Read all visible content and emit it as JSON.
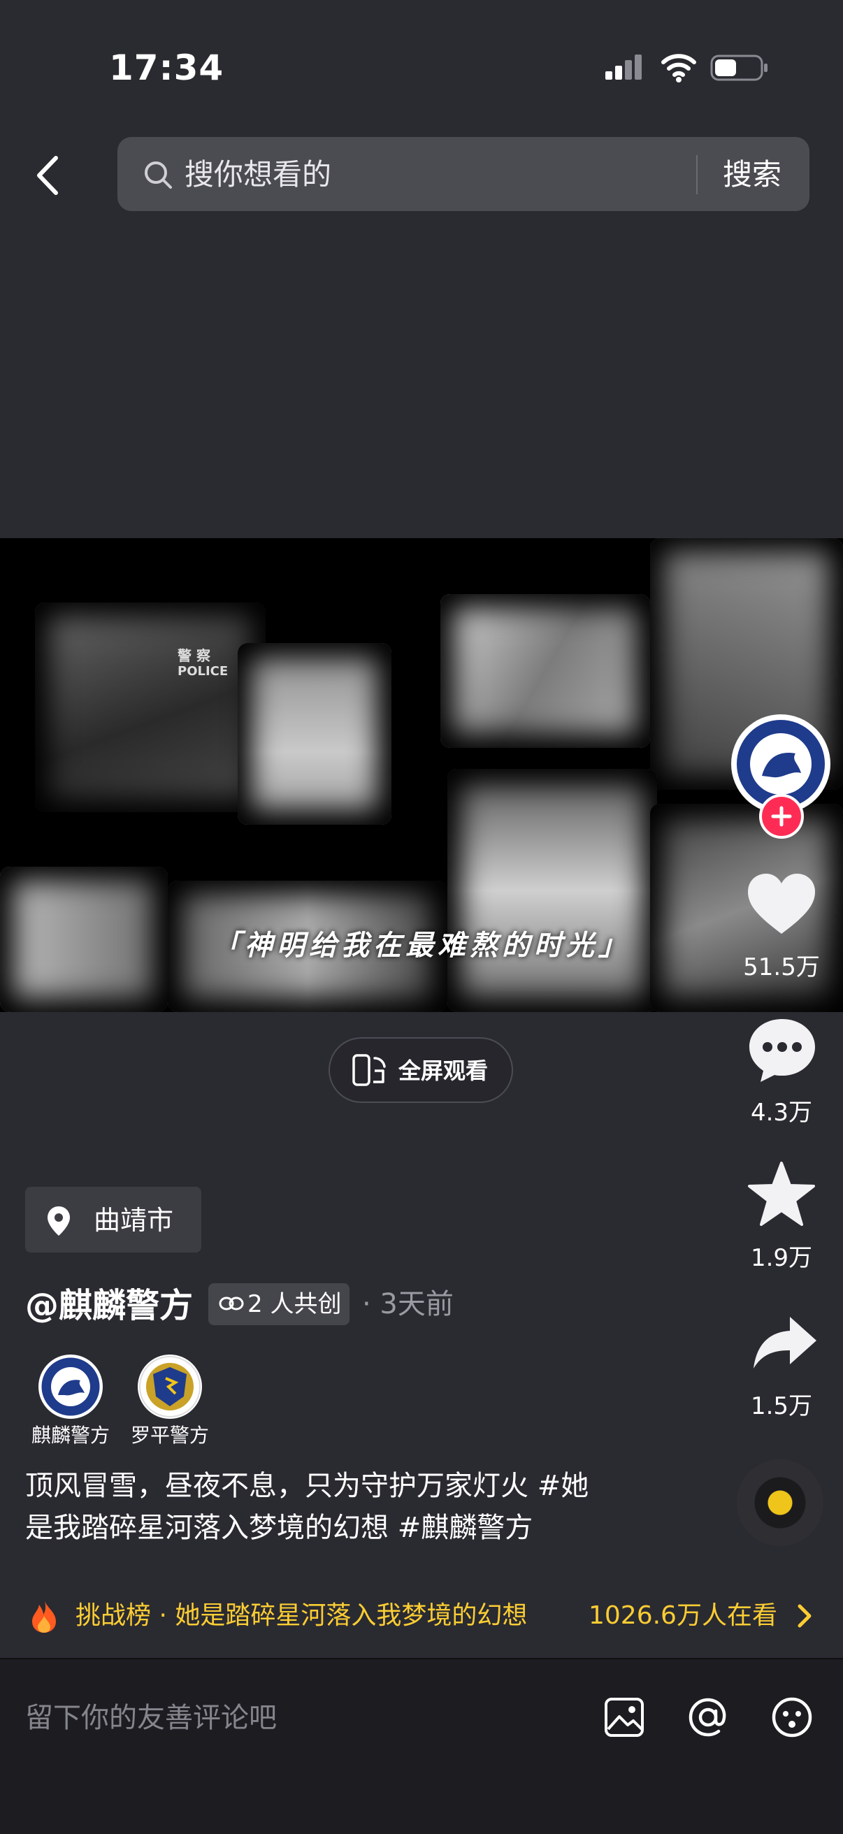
{
  "status": {
    "time": "17:34"
  },
  "search": {
    "placeholder": "搜你想看的",
    "button": "搜索"
  },
  "video": {
    "caption": "「神明给我在最难熬的时光」",
    "uniform_text": "POLICE",
    "uniform_text_cn": "警 察"
  },
  "fullscreen": {
    "label": "全屏观看"
  },
  "rail": {
    "like_count": "51.5万",
    "comment_count": "4.3万",
    "favorite_count": "1.9万",
    "share_count": "1.5万"
  },
  "location": {
    "label": "曲靖市"
  },
  "author": {
    "name": "@麒麟警方",
    "cocreate": "2 人共创",
    "time": "· 3天前"
  },
  "cocreators": [
    {
      "name": "麒麟警方"
    },
    {
      "name": "罗平警方"
    }
  ],
  "caption": {
    "line1": "顶风冒雪，昼夜不息，只为守护万家灯火 #她",
    "line2": "是我踏碎星河落入梦境的幻想 #麒麟警方"
  },
  "challenge": {
    "text": "挑战榜 · 她是踏碎星河落入我梦境的幻想",
    "count": "1026.6万人在看"
  },
  "comment": {
    "placeholder": "留下你的友善评论吧"
  },
  "colors": {
    "accent_red": "#fe2c55",
    "challenge_yellow": "#fbcd33",
    "background": "#2a2a31"
  }
}
